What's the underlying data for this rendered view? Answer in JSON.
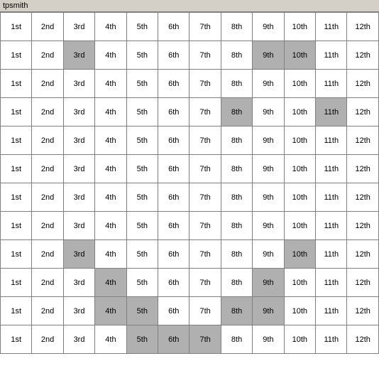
{
  "title": "tpsmith",
  "cols": [
    "1st",
    "2nd",
    "3rd",
    "4th",
    "5th",
    "6th",
    "7th",
    "8th",
    "9th",
    "10th",
    "11th",
    "12th"
  ],
  "rows": [
    {
      "cells": [
        {
          "text": "1st",
          "bg": "white"
        },
        {
          "text": "2nd",
          "bg": "white"
        },
        {
          "text": "3rd",
          "bg": "white"
        },
        {
          "text": "4th",
          "bg": "white"
        },
        {
          "text": "5th",
          "bg": "white"
        },
        {
          "text": "6th",
          "bg": "white"
        },
        {
          "text": "7th",
          "bg": "white"
        },
        {
          "text": "8th",
          "bg": "white"
        },
        {
          "text": "9th",
          "bg": "white"
        },
        {
          "text": "10th",
          "bg": "white"
        },
        {
          "text": "11th",
          "bg": "white"
        },
        {
          "text": "12th",
          "bg": "white"
        }
      ]
    },
    {
      "cells": [
        {
          "text": "1st",
          "bg": "white"
        },
        {
          "text": "2nd",
          "bg": "white"
        },
        {
          "text": "3rd",
          "bg": "gray"
        },
        {
          "text": "4th",
          "bg": "white"
        },
        {
          "text": "5th",
          "bg": "white"
        },
        {
          "text": "6th",
          "bg": "white"
        },
        {
          "text": "7th",
          "bg": "white"
        },
        {
          "text": "8th",
          "bg": "white"
        },
        {
          "text": "9th",
          "bg": "gray"
        },
        {
          "text": "10th",
          "bg": "gray"
        },
        {
          "text": "11th",
          "bg": "white"
        },
        {
          "text": "12th",
          "bg": "white"
        }
      ]
    },
    {
      "cells": [
        {
          "text": "1st",
          "bg": "white"
        },
        {
          "text": "2nd",
          "bg": "white"
        },
        {
          "text": "3rd",
          "bg": "white"
        },
        {
          "text": "4th",
          "bg": "white"
        },
        {
          "text": "5th",
          "bg": "white"
        },
        {
          "text": "6th",
          "bg": "white"
        },
        {
          "text": "7th",
          "bg": "white"
        },
        {
          "text": "8th",
          "bg": "white"
        },
        {
          "text": "9th",
          "bg": "white"
        },
        {
          "text": "10th",
          "bg": "white"
        },
        {
          "text": "11th",
          "bg": "white"
        },
        {
          "text": "12th",
          "bg": "white"
        }
      ]
    },
    {
      "cells": [
        {
          "text": "1st",
          "bg": "white"
        },
        {
          "text": "2nd",
          "bg": "white"
        },
        {
          "text": "3rd",
          "bg": "white"
        },
        {
          "text": "4th",
          "bg": "white"
        },
        {
          "text": "5th",
          "bg": "white"
        },
        {
          "text": "6th",
          "bg": "white"
        },
        {
          "text": "7th",
          "bg": "white"
        },
        {
          "text": "8th",
          "bg": "gray"
        },
        {
          "text": "9th",
          "bg": "white"
        },
        {
          "text": "10th",
          "bg": "white"
        },
        {
          "text": "11th",
          "bg": "gray"
        },
        {
          "text": "12th",
          "bg": "white"
        }
      ]
    },
    {
      "cells": [
        {
          "text": "1st",
          "bg": "white"
        },
        {
          "text": "2nd",
          "bg": "white"
        },
        {
          "text": "3rd",
          "bg": "white"
        },
        {
          "text": "4th",
          "bg": "white"
        },
        {
          "text": "5th",
          "bg": "white"
        },
        {
          "text": "6th",
          "bg": "white"
        },
        {
          "text": "7th",
          "bg": "white"
        },
        {
          "text": "8th",
          "bg": "white"
        },
        {
          "text": "9th",
          "bg": "white"
        },
        {
          "text": "10th",
          "bg": "white"
        },
        {
          "text": "11th",
          "bg": "white"
        },
        {
          "text": "12th",
          "bg": "white"
        }
      ]
    },
    {
      "cells": [
        {
          "text": "1st",
          "bg": "white"
        },
        {
          "text": "2nd",
          "bg": "white"
        },
        {
          "text": "3rd",
          "bg": "white"
        },
        {
          "text": "4th",
          "bg": "white"
        },
        {
          "text": "5th",
          "bg": "white"
        },
        {
          "text": "6th",
          "bg": "white"
        },
        {
          "text": "7th",
          "bg": "white"
        },
        {
          "text": "8th",
          "bg": "white"
        },
        {
          "text": "9th",
          "bg": "white"
        },
        {
          "text": "10th",
          "bg": "white"
        },
        {
          "text": "11th",
          "bg": "white"
        },
        {
          "text": "12th",
          "bg": "white"
        }
      ]
    },
    {
      "cells": [
        {
          "text": "1st",
          "bg": "white"
        },
        {
          "text": "2nd",
          "bg": "white"
        },
        {
          "text": "3rd",
          "bg": "white"
        },
        {
          "text": "4th",
          "bg": "white"
        },
        {
          "text": "5th",
          "bg": "white"
        },
        {
          "text": "6th",
          "bg": "white"
        },
        {
          "text": "7th",
          "bg": "white"
        },
        {
          "text": "8th",
          "bg": "white"
        },
        {
          "text": "9th",
          "bg": "white"
        },
        {
          "text": "10th",
          "bg": "white"
        },
        {
          "text": "11th",
          "bg": "white"
        },
        {
          "text": "12th",
          "bg": "white"
        }
      ]
    },
    {
      "cells": [
        {
          "text": "1st",
          "bg": "white"
        },
        {
          "text": "2nd",
          "bg": "white"
        },
        {
          "text": "3rd",
          "bg": "white"
        },
        {
          "text": "4th",
          "bg": "white"
        },
        {
          "text": "5th",
          "bg": "white"
        },
        {
          "text": "6th",
          "bg": "white"
        },
        {
          "text": "7th",
          "bg": "white"
        },
        {
          "text": "8th",
          "bg": "white"
        },
        {
          "text": "9th",
          "bg": "white"
        },
        {
          "text": "10th",
          "bg": "white"
        },
        {
          "text": "11th",
          "bg": "white"
        },
        {
          "text": "12th",
          "bg": "white"
        }
      ]
    },
    {
      "cells": [
        {
          "text": "1st",
          "bg": "white"
        },
        {
          "text": "2nd",
          "bg": "white"
        },
        {
          "text": "3rd",
          "bg": "gray"
        },
        {
          "text": "4th",
          "bg": "white"
        },
        {
          "text": "5th",
          "bg": "white"
        },
        {
          "text": "6th",
          "bg": "white"
        },
        {
          "text": "7th",
          "bg": "white"
        },
        {
          "text": "8th",
          "bg": "white"
        },
        {
          "text": "9th",
          "bg": "white"
        },
        {
          "text": "10th",
          "bg": "gray"
        },
        {
          "text": "11th",
          "bg": "white"
        },
        {
          "text": "12th",
          "bg": "white"
        }
      ]
    },
    {
      "cells": [
        {
          "text": "1st",
          "bg": "white"
        },
        {
          "text": "2nd",
          "bg": "white"
        },
        {
          "text": "3rd",
          "bg": "white"
        },
        {
          "text": "4th",
          "bg": "gray"
        },
        {
          "text": "5th",
          "bg": "white"
        },
        {
          "text": "6th",
          "bg": "white"
        },
        {
          "text": "7th",
          "bg": "white"
        },
        {
          "text": "8th",
          "bg": "white"
        },
        {
          "text": "9th",
          "bg": "gray"
        },
        {
          "text": "10th",
          "bg": "white"
        },
        {
          "text": "11th",
          "bg": "white"
        },
        {
          "text": "12th",
          "bg": "white"
        }
      ]
    },
    {
      "cells": [
        {
          "text": "1st",
          "bg": "white"
        },
        {
          "text": "2nd",
          "bg": "white"
        },
        {
          "text": "3rd",
          "bg": "white"
        },
        {
          "text": "4th",
          "bg": "gray"
        },
        {
          "text": "5th",
          "bg": "gray"
        },
        {
          "text": "6th",
          "bg": "white"
        },
        {
          "text": "7th",
          "bg": "white"
        },
        {
          "text": "8th",
          "bg": "gray"
        },
        {
          "text": "9th",
          "bg": "gray"
        },
        {
          "text": "10th",
          "bg": "white"
        },
        {
          "text": "11th",
          "bg": "white"
        },
        {
          "text": "12th",
          "bg": "white"
        }
      ]
    },
    {
      "cells": [
        {
          "text": "1st",
          "bg": "white"
        },
        {
          "text": "2nd",
          "bg": "white"
        },
        {
          "text": "3rd",
          "bg": "white"
        },
        {
          "text": "4th",
          "bg": "white"
        },
        {
          "text": "5th",
          "bg": "gray"
        },
        {
          "text": "6th",
          "bg": "gray"
        },
        {
          "text": "7th",
          "bg": "gray"
        },
        {
          "text": "8th",
          "bg": "white"
        },
        {
          "text": "9th",
          "bg": "white"
        },
        {
          "text": "10th",
          "bg": "white"
        },
        {
          "text": "11th",
          "bg": "white"
        },
        {
          "text": "12th",
          "bg": "white"
        }
      ]
    }
  ]
}
